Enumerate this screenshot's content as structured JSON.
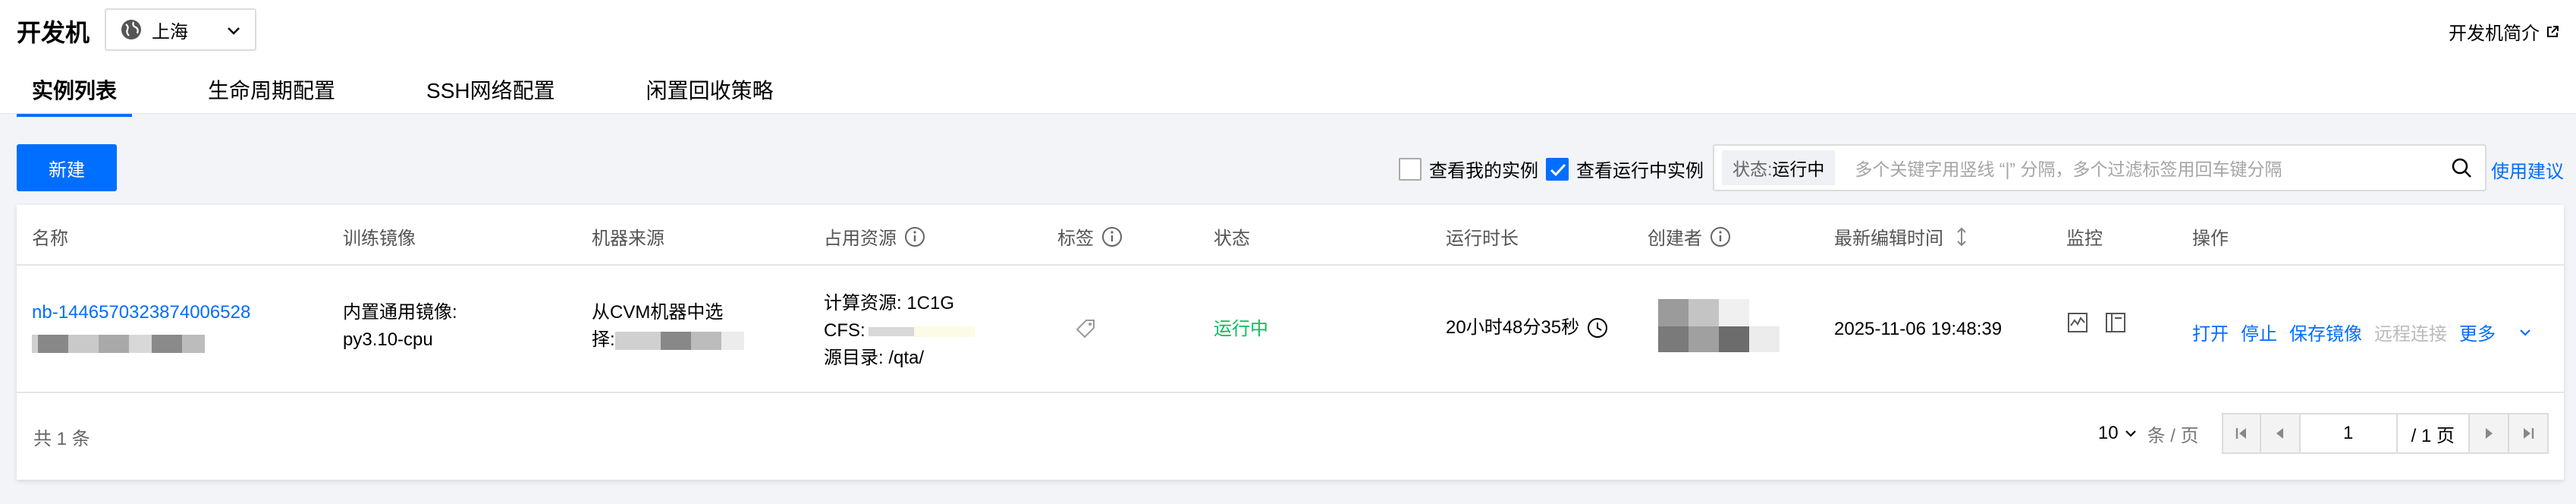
{
  "header": {
    "title": "开发机",
    "region": "上海",
    "intro_link": "开发机简介"
  },
  "tabs": [
    {
      "label": "实例列表",
      "active": true
    },
    {
      "label": "生命周期配置",
      "active": false
    },
    {
      "label": "SSH网络配置",
      "active": false
    },
    {
      "label": "闲置回收策略",
      "active": false
    }
  ],
  "toolbar": {
    "new_button": "新建",
    "check_mine": {
      "label": "查看我的实例",
      "checked": false
    },
    "check_running": {
      "label": "查看运行中实例",
      "checked": true
    },
    "search_tag_key": "状态:",
    "search_tag_value": "运行中",
    "search_placeholder": "多个关键字用竖线 “|” 分隔，多个过滤标签用回车键分隔",
    "help_link": "使用建议"
  },
  "table": {
    "columns": [
      "名称",
      "训练镜像",
      "机器来源",
      "占用资源",
      "标签",
      "状态",
      "运行时长",
      "创建者",
      "最新编辑时间",
      "监控",
      "操作"
    ],
    "rows": [
      {
        "name": "nb-1446570323874006528",
        "image_line1": "内置通用镜像:",
        "image_line2": "py3.10-cpu",
        "source_line1": "从CVM机器中选",
        "source_line2": "择:",
        "resource_compute": "计算资源: 1C1G",
        "resource_cfs": "CFS:",
        "resource_dir": "源目录: /qta/",
        "status": "运行中",
        "duration": "20小时48分35秒",
        "edited": "2025-11-06 19:48:39",
        "ops": [
          "打开",
          "停止",
          "保存镜像",
          "远程连接",
          "更多"
        ]
      }
    ]
  },
  "footer": {
    "total": "共 1 条",
    "page_size": "10",
    "page_unit": "条 / 页",
    "page_current": "1",
    "page_total": "/ 1 页"
  },
  "colors": {
    "accent": "#006eff",
    "running": "#0abf5b"
  }
}
